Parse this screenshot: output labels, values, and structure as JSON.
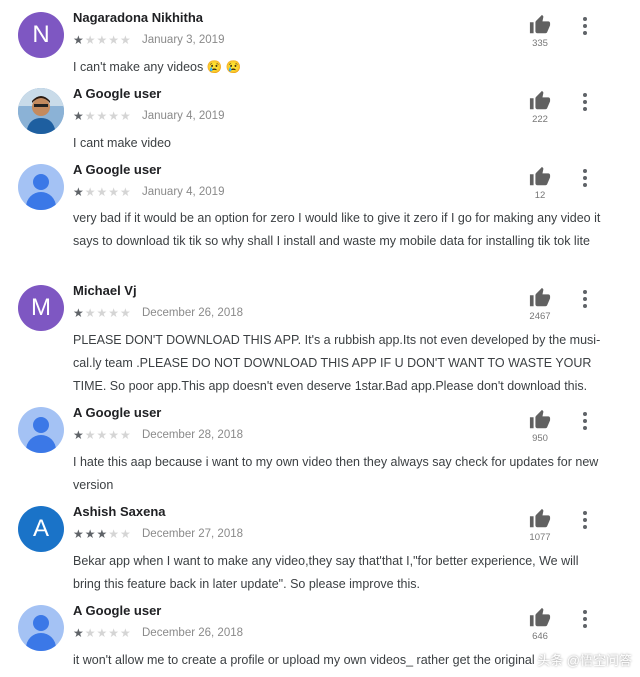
{
  "reviews": [
    {
      "name": "Nagaradona Nikhitha",
      "initial": "N",
      "avatar_color": "#7e57c2",
      "rating": 1,
      "date": "January 3, 2019",
      "text": "I can't make any videos 😢 😢",
      "likes": "335"
    },
    {
      "name": "A Google user",
      "initial": "",
      "avatar_color": "#7aa3c9",
      "rating": 1,
      "date": "January 4, 2019",
      "text": "I cant make video",
      "likes": "222"
    },
    {
      "name": "A Google user",
      "initial": "",
      "avatar_color": "#a4c2f4",
      "rating": 1,
      "date": "January 4, 2019",
      "text": "very bad if it would be an option for zero I would like to give it zero if I go for making any video it says to download tik tik so why shall I install and waste my mobile data for installing tik tok lite",
      "likes": "12"
    },
    {
      "name": "Michael Vj",
      "initial": "M",
      "avatar_color": "#7e57c2",
      "rating": 1,
      "date": "December 26, 2018",
      "text": "PLEASE DON'T DOWNLOAD THIS APP. It's a rubbish app.Its not even developed by the musi-cal.ly team .PLEASE DO NOT DOWNLOAD THIS APP IF U DON'T WANT TO WASTE YOUR TIME. So poor app.This app doesn't even deserve 1star.Bad app.Please don't download this.",
      "likes": "2467"
    },
    {
      "name": "A Google user",
      "initial": "",
      "avatar_color": "#a4c2f4",
      "rating": 1,
      "date": "December 28, 2018",
      "text": "I hate this aap because i want to my own video then they always say check for updates for new version",
      "likes": "950"
    },
    {
      "name": "Ashish Saxena",
      "initial": "A",
      "avatar_color": "#1a73c8",
      "rating": 3,
      "date": "December 27, 2018",
      "text": "Bekar app when I want to make any video,they say that'that I,\"for better experience, We will bring this feature back in later update\". So please improve this.",
      "likes": "1077"
    },
    {
      "name": "A Google user",
      "initial": "",
      "avatar_color": "#a4c2f4",
      "rating": 1,
      "date": "December 26, 2018",
      "text": "it won't allow me to create a profile or upload my own videos_ rather get the original",
      "likes": "646"
    }
  ],
  "icons": {
    "like": "thumbs-up-icon",
    "menu": "more-vert-icon"
  },
  "colors": {
    "icon": "#616161",
    "star_on": "#5f6368",
    "star_off": "#d5d5d5"
  },
  "watermark": "头条 @悟空问答"
}
